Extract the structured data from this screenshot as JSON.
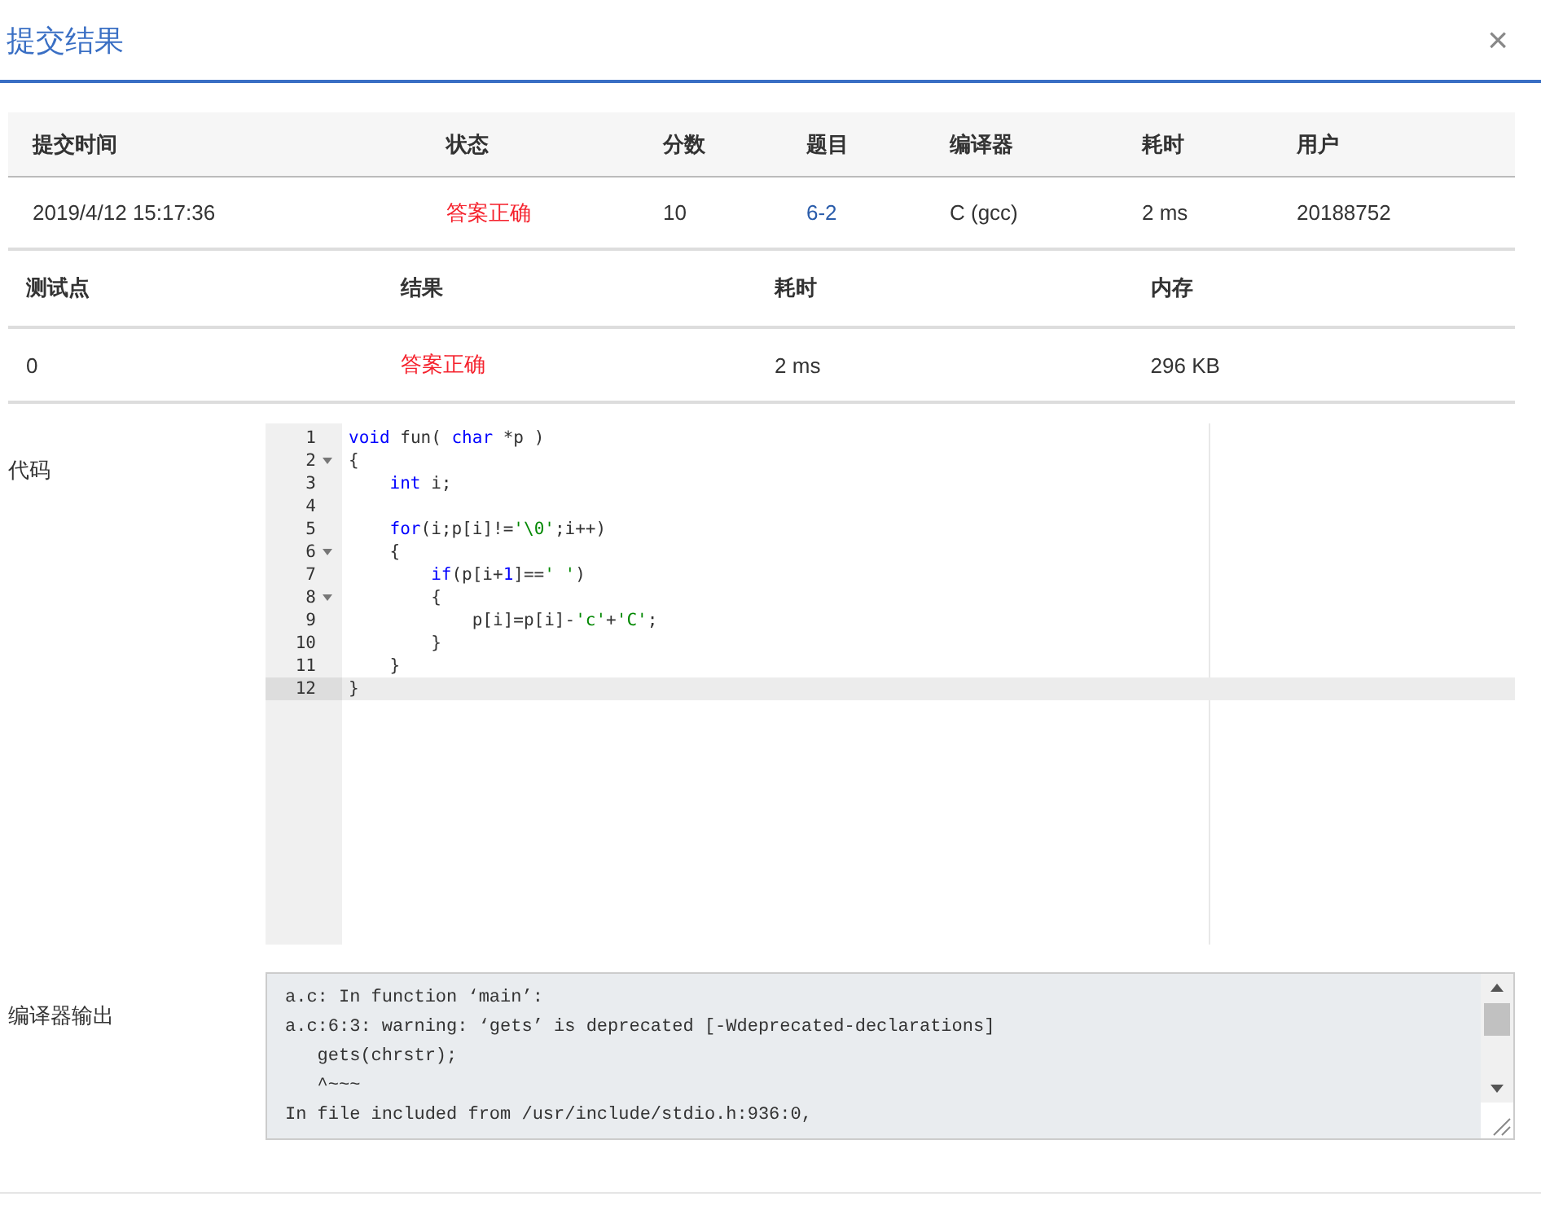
{
  "dialog": {
    "title": "提交结果",
    "close": "×"
  },
  "summary": {
    "columns": [
      "提交时间",
      "状态",
      "分数",
      "题目",
      "编译器",
      "耗时",
      "用户"
    ],
    "rows": [
      [
        {
          "text": "2019/4/12 15:17:36",
          "kind": "text"
        },
        {
          "text": "答案正确",
          "kind": "status"
        },
        {
          "text": "10",
          "kind": "text"
        },
        {
          "text": "6-2",
          "kind": "link"
        },
        {
          "text": "C (gcc)",
          "kind": "text"
        },
        {
          "text": "2 ms",
          "kind": "text"
        },
        {
          "text": "20188752",
          "kind": "text"
        }
      ]
    ]
  },
  "tests": {
    "columns": [
      "测试点",
      "结果",
      "耗时",
      "内存"
    ],
    "rows": [
      [
        {
          "text": "0",
          "kind": "text"
        },
        {
          "text": "答案正确",
          "kind": "status"
        },
        {
          "text": "2 ms",
          "kind": "text"
        },
        {
          "text": "296 KB",
          "kind": "text"
        }
      ]
    ]
  },
  "code": {
    "label": "代码",
    "lines": [
      {
        "number": "1",
        "foldable": false,
        "active": false,
        "tokens": [
          {
            "text": "void",
            "kind": "kw"
          },
          {
            "text": " fun( ",
            "kind": "plain"
          },
          {
            "text": "char",
            "kind": "kw"
          },
          {
            "text": " *p )",
            "kind": "plain"
          }
        ]
      },
      {
        "number": "2",
        "foldable": true,
        "active": false,
        "tokens": [
          {
            "text": "{",
            "kind": "plain"
          }
        ]
      },
      {
        "number": "3",
        "foldable": false,
        "active": false,
        "tokens": [
          {
            "text": "    int",
            "kind": "kw"
          },
          {
            "text": " i;",
            "kind": "plain"
          }
        ]
      },
      {
        "number": "4",
        "foldable": false,
        "active": false
      },
      {
        "number": "5",
        "foldable": false,
        "active": false,
        "tokens": [
          {
            "text": "    for",
            "kind": "kw"
          },
          {
            "text": "(i;p[i]!=",
            "kind": "plain"
          },
          {
            "text": "'\\0'",
            "kind": "str"
          },
          {
            "text": ";i++)",
            "kind": "plain"
          }
        ]
      },
      {
        "number": "6",
        "foldable": true,
        "active": false,
        "tokens": [
          {
            "text": "    {",
            "kind": "plain"
          }
        ]
      },
      {
        "number": "7",
        "foldable": false,
        "active": false,
        "tokens": [
          {
            "text": "        if",
            "kind": "kw"
          },
          {
            "text": "(p[i+",
            "kind": "plain"
          },
          {
            "text": "1",
            "kind": "num"
          },
          {
            "text": "]==",
            "kind": "plain"
          },
          {
            "text": "' '",
            "kind": "str"
          },
          {
            "text": ")",
            "kind": "plain"
          }
        ]
      },
      {
        "number": "8",
        "foldable": true,
        "active": false,
        "tokens": [
          {
            "text": "        {",
            "kind": "plain"
          }
        ]
      },
      {
        "number": "9",
        "foldable": false,
        "active": false,
        "tokens": [
          {
            "text": "            p[i]=p[i]-",
            "kind": "plain"
          },
          {
            "text": "'c'",
            "kind": "str"
          },
          {
            "text": "+",
            "kind": "plain"
          },
          {
            "text": "'C'",
            "kind": "str"
          },
          {
            "text": ";",
            "kind": "plain"
          }
        ]
      },
      {
        "number": "10",
        "foldable": false,
        "active": false,
        "tokens": [
          {
            "text": "        }",
            "kind": "plain"
          }
        ]
      },
      {
        "number": "11",
        "foldable": false,
        "active": false,
        "tokens": [
          {
            "text": "    }",
            "kind": "plain"
          }
        ]
      },
      {
        "number": "12",
        "foldable": false,
        "active": true,
        "tokens": [
          {
            "text": "}",
            "kind": "plain"
          }
        ]
      }
    ]
  },
  "compiler_output": {
    "label": "编译器输出",
    "lines": [
      "a.c: In function ‘main’:",
      "a.c:6:3: warning: ‘gets’ is deprecated [-Wdeprecated-declarations]",
      "   gets(chrstr);",
      "   ^~~~",
      "In file included from /usr/include/stdio.h:936:0,"
    ]
  }
}
